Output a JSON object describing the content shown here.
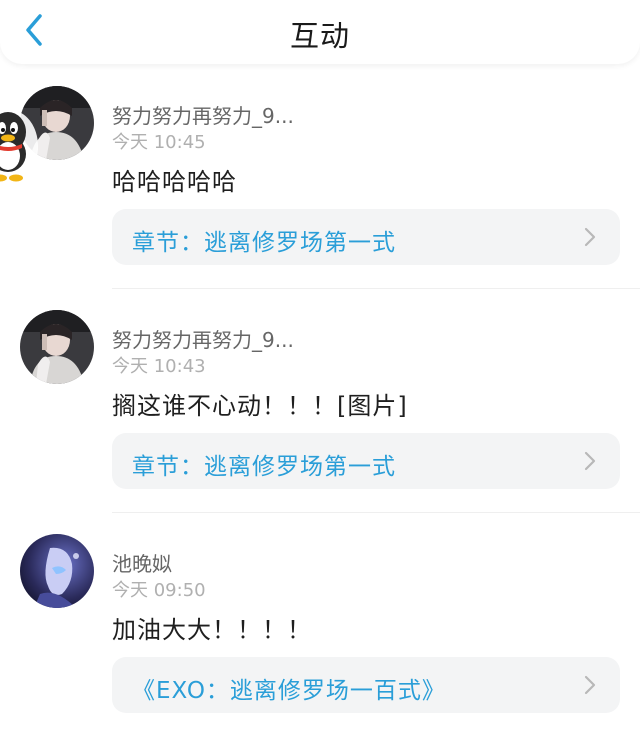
{
  "header": {
    "title": "互动",
    "back_icon": "chevron-left-icon"
  },
  "colors": {
    "accent": "#2a9ed8",
    "link_bg": "#f3f4f5",
    "username": "#666666",
    "timestamp": "#b0b0b0"
  },
  "interactions": [
    {
      "username": "努力努力再努力_9...",
      "timestamp": "今天 10:45",
      "comment": "哈哈哈哈哈",
      "link": "章节：逃离修罗场第一式"
    },
    {
      "username": "努力努力再努力_9...",
      "timestamp": "今天 10:43",
      "comment": "搁这谁不心动！！！[图片]",
      "link": "章节：逃离修罗场第一式"
    },
    {
      "username": "池晚姒",
      "timestamp": "今天 09:50",
      "comment": "加油大大！！！！",
      "link": "《EXO：逃离修罗场一百式》"
    }
  ]
}
